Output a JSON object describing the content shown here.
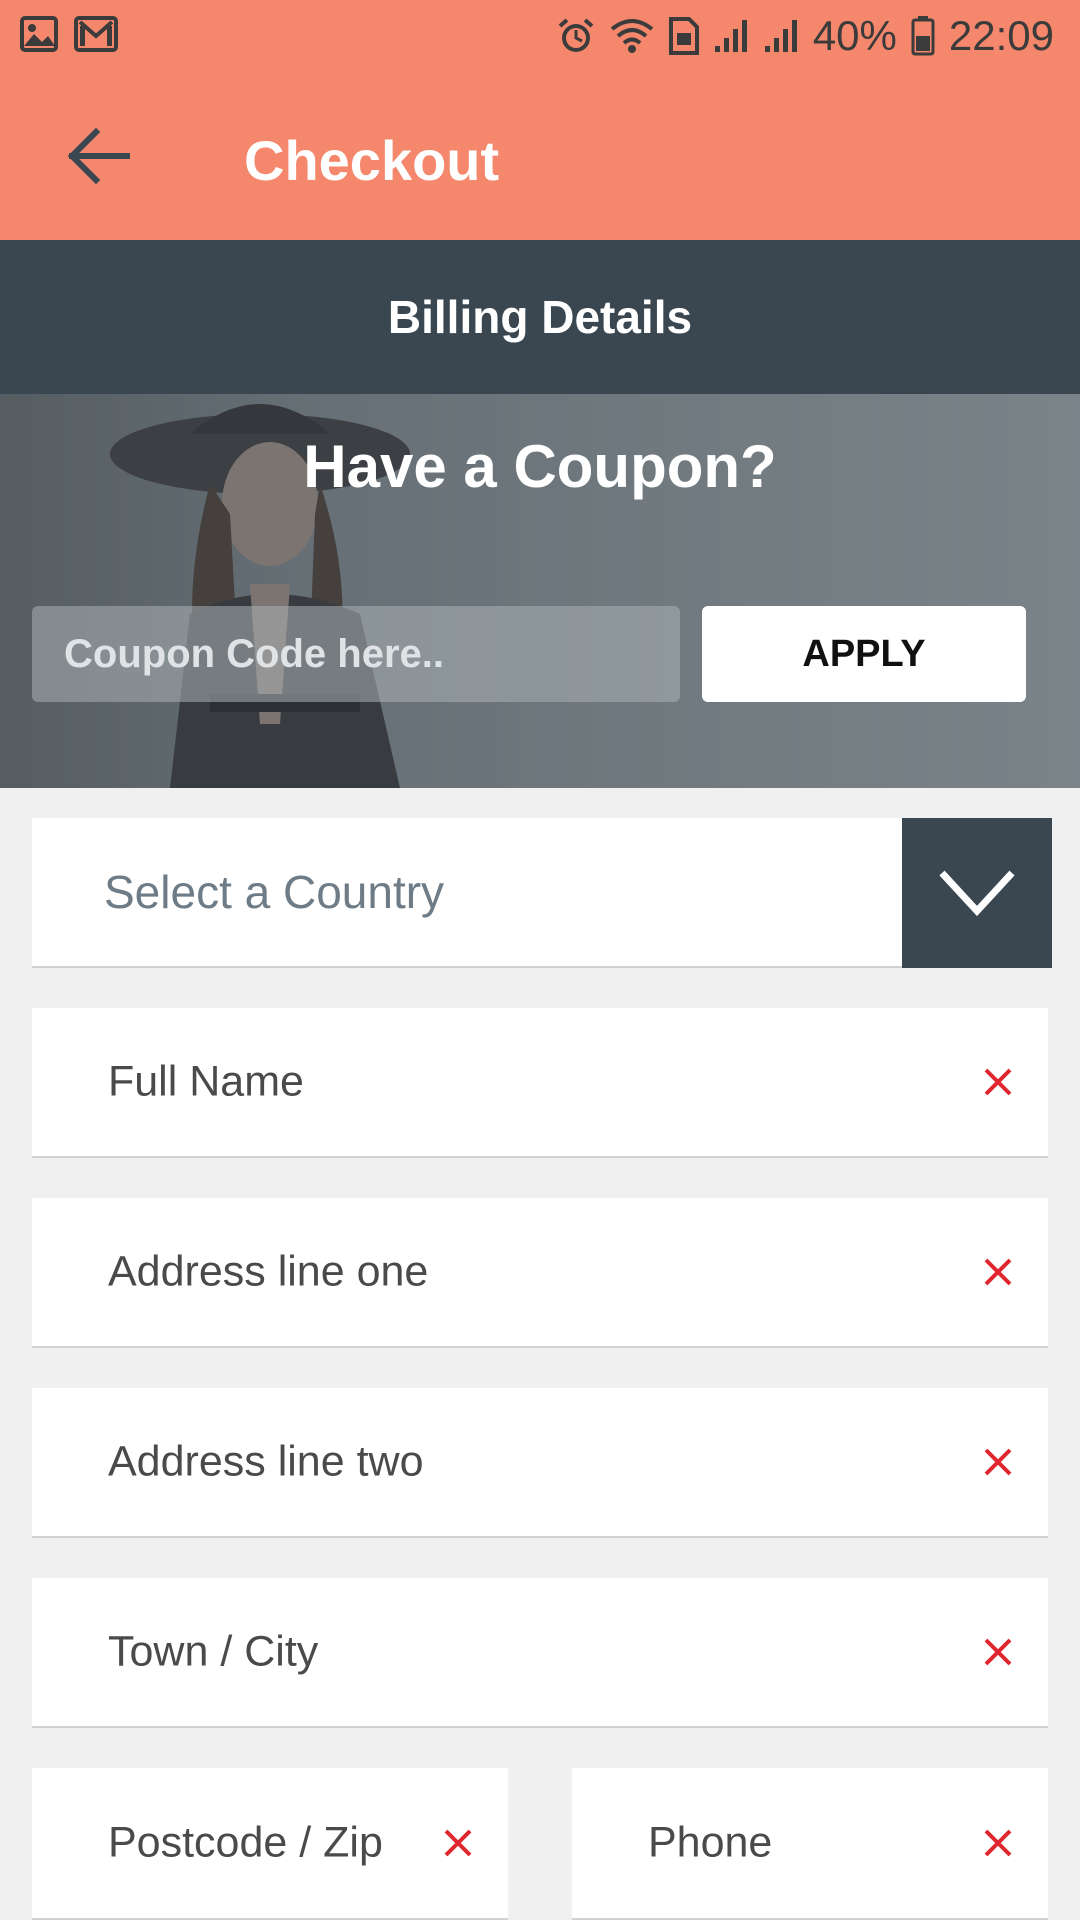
{
  "status_bar": {
    "battery": "40%",
    "time": "22:09",
    "icons": [
      "image-icon",
      "gmail-icon",
      "alarm-icon",
      "wifi-icon",
      "sim-icon",
      "signal-icon",
      "signal-icon",
      "battery-icon"
    ]
  },
  "app_bar": {
    "title": "Checkout",
    "back_icon": "arrow-back-icon"
  },
  "section_header": {
    "title": "Billing Details"
  },
  "coupon": {
    "title": "Have a Coupon?",
    "placeholder": "Coupon Code here..",
    "value": "",
    "apply_label": "APPLY"
  },
  "form": {
    "country_placeholder": "Select a Country",
    "full_name": "Full Name",
    "address_one": "Address line one",
    "address_two": "Address line two",
    "town_city": "Town / City",
    "postcode": "Postcode / Zip",
    "phone": "Phone"
  },
  "colors": {
    "app_bar": "#f4876c",
    "header": "#3a4750",
    "clear_icon": "#e0262e",
    "background": "#f0f0f0"
  }
}
